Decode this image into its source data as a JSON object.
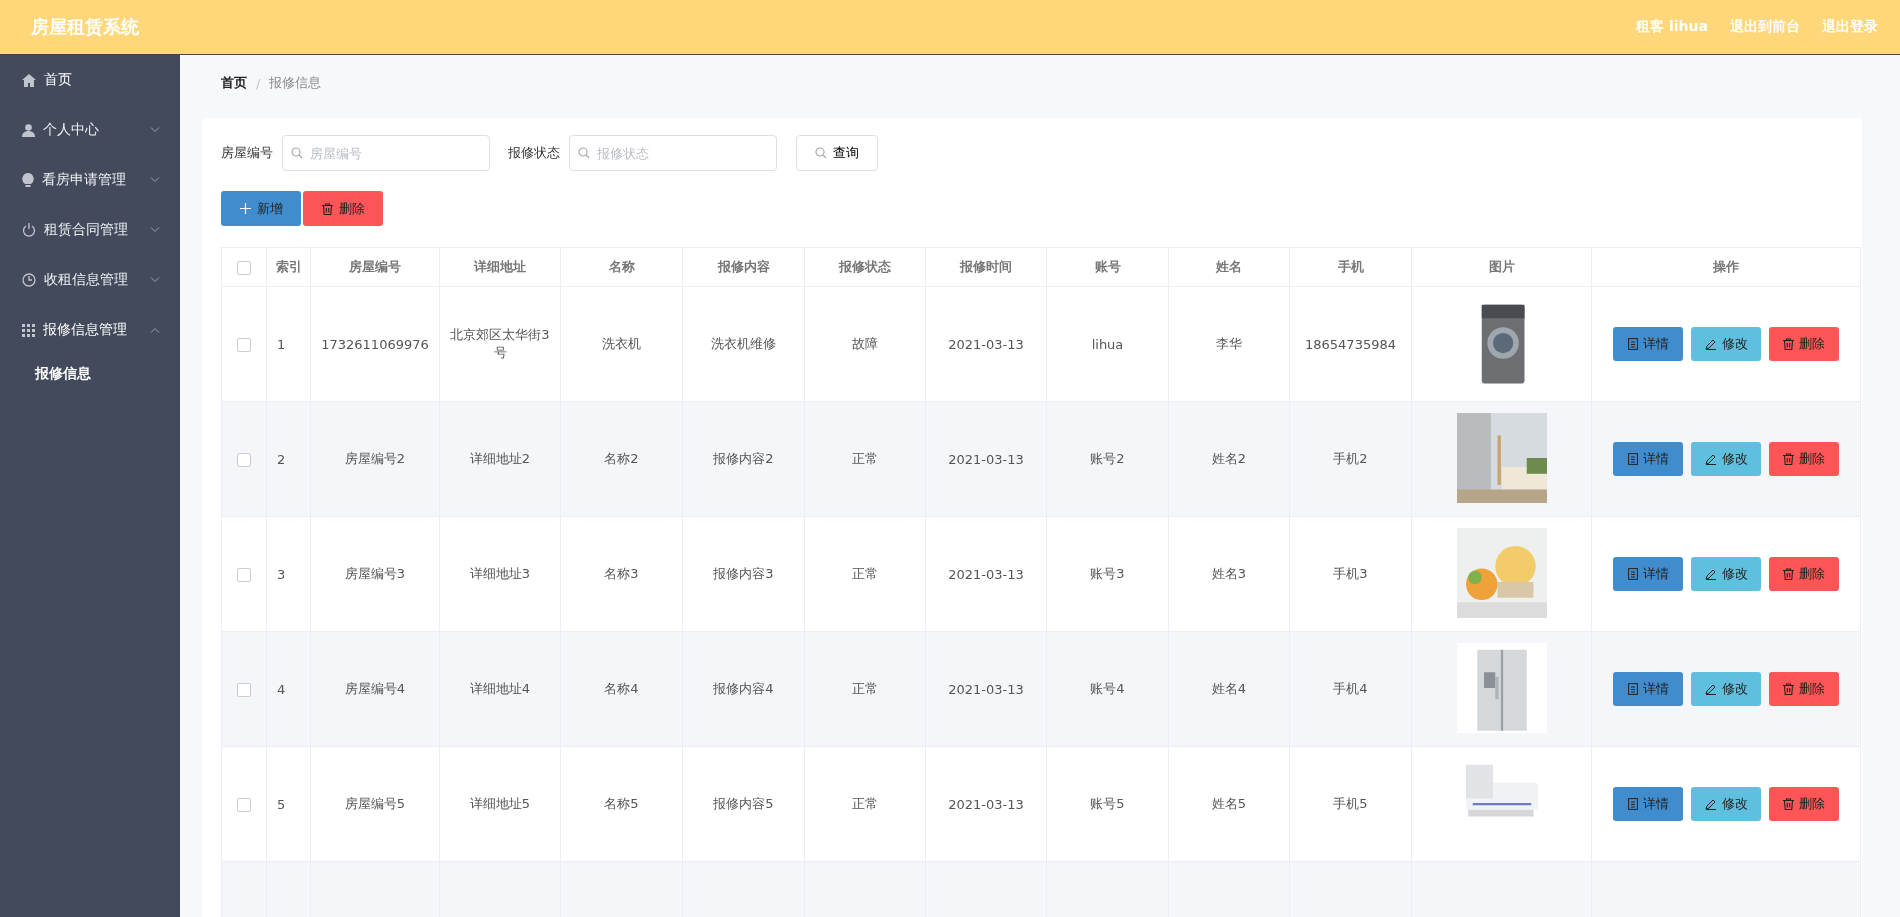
{
  "header": {
    "title": "房屋租赁系统",
    "links": [
      "租客 lihua",
      "退出到前台",
      "退出登录"
    ]
  },
  "sidebar": {
    "items": [
      {
        "label": "首页",
        "kind": "plain"
      },
      {
        "label": "个人中心",
        "kind": "group",
        "expanded": false
      },
      {
        "label": "看房申请管理",
        "kind": "group",
        "expanded": false
      },
      {
        "label": "租赁合同管理",
        "kind": "group",
        "expanded": false
      },
      {
        "label": "收租信息管理",
        "kind": "group",
        "expanded": false
      },
      {
        "label": "报修信息管理",
        "kind": "group",
        "expanded": true,
        "children": [
          {
            "label": "报修信息",
            "selected": true
          }
        ]
      }
    ]
  },
  "breadcrumb": [
    "首页",
    "/",
    "报修信息"
  ],
  "filters": [
    {
      "label": "房屋编号",
      "placeholder": "房屋编号"
    },
    {
      "label": "报修状态",
      "placeholder": "报修状态"
    }
  ],
  "search_button": "查询",
  "toolbar": [
    {
      "label": "新增",
      "kind": "add"
    },
    {
      "label": "删除",
      "kind": "delete"
    }
  ],
  "table": {
    "header_checked": false,
    "columns": [
      "索引",
      "房屋编号",
      "详细地址",
      "名称",
      "报修内容",
      "报修状态",
      "报修时间",
      "账号",
      "姓名",
      "手机",
      "图片",
      "操作"
    ],
    "rows": [
      {
        "checked": false,
        "cells": [
          "1",
          "1732611069976",
          "北京郊区太华街3号",
          "洗衣机",
          "洗衣机维修",
          "故障",
          "2021-03-13",
          "lihua",
          "李华",
          "18654735984"
        ],
        "actions": [
          "详情",
          "修改",
          "删除"
        ]
      },
      {
        "checked": false,
        "cells": [
          "2",
          "房屋编号2",
          "详细地址2",
          "名称2",
          "报修内容2",
          "正常",
          "2021-03-13",
          "账号2",
          "姓名2",
          "手机2"
        ],
        "actions": [
          "详情",
          "修改",
          "删除"
        ]
      },
      {
        "checked": false,
        "cells": [
          "3",
          "房屋编号3",
          "详细地址3",
          "名称3",
          "报修内容3",
          "正常",
          "2021-03-13",
          "账号3",
          "姓名3",
          "手机3"
        ],
        "actions": [
          "详情",
          "修改",
          "删除"
        ]
      },
      {
        "checked": false,
        "cells": [
          "4",
          "房屋编号4",
          "详细地址4",
          "名称4",
          "报修内容4",
          "正常",
          "2021-03-13",
          "账号4",
          "姓名4",
          "手机4"
        ],
        "actions": [
          "详情",
          "修改",
          "删除"
        ]
      },
      {
        "checked": false,
        "cells": [
          "5",
          "房屋编号5",
          "详细地址5",
          "名称5",
          "报修内容5",
          "正常",
          "2021-03-13",
          "账号5",
          "姓名5",
          "手机5"
        ],
        "actions": [
          "详情",
          "修改",
          "删除"
        ]
      }
    ]
  }
}
